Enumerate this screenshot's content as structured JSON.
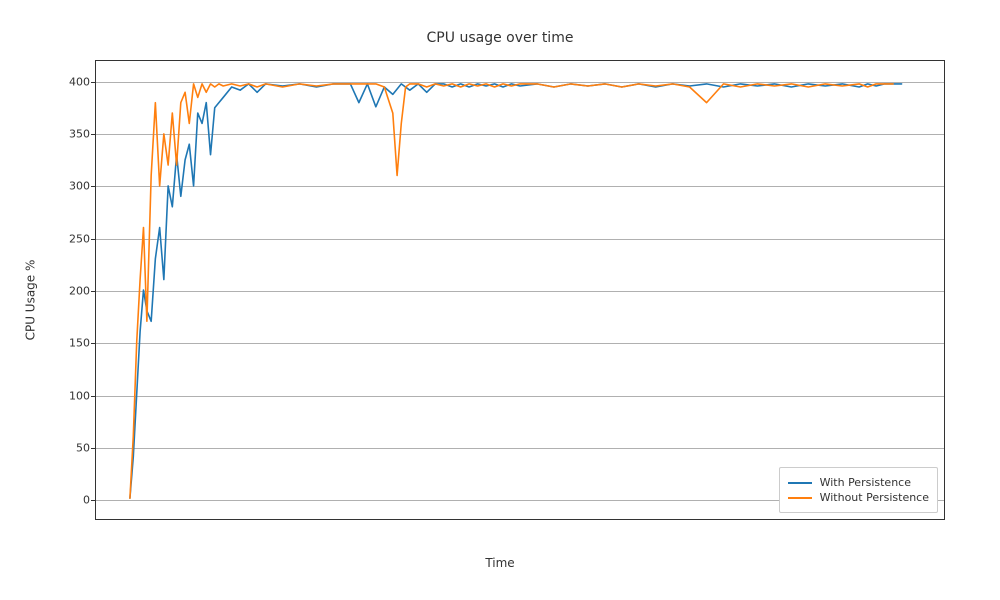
{
  "chart_data": {
    "type": "line",
    "title": "CPU usage over time",
    "xlabel": "Time",
    "ylabel": "CPU Usage %",
    "ylim": [
      -20,
      420
    ],
    "xlim": [
      0,
      100
    ],
    "yticks": [
      0,
      50,
      100,
      150,
      200,
      250,
      300,
      350,
      400
    ],
    "legend_position": "lower right",
    "grid": true,
    "series": [
      {
        "name": "With Persistence",
        "color": "#1f77b4",
        "x": [
          4,
          4.4,
          4.8,
          5.2,
          5.6,
          6,
          6.5,
          7,
          7.5,
          8,
          8.5,
          9,
          9.5,
          10,
          10.5,
          11,
          11.5,
          12,
          12.5,
          13,
          13.5,
          14,
          14.5,
          15,
          16,
          17,
          18,
          19,
          20,
          22,
          24,
          26,
          28,
          30,
          31,
          32,
          33,
          34,
          35,
          36,
          37,
          38,
          39,
          40,
          41,
          42,
          43,
          44,
          45,
          46,
          47,
          48,
          49,
          50,
          52,
          54,
          56,
          58,
          60,
          62,
          64,
          66,
          68,
          70,
          72,
          74,
          76,
          78,
          80,
          82,
          84,
          86,
          88,
          90,
          91,
          92,
          93,
          94,
          95
        ],
        "y": [
          0,
          40,
          100,
          160,
          200,
          180,
          170,
          230,
          260,
          210,
          300,
          280,
          330,
          290,
          325,
          340,
          300,
          370,
          360,
          380,
          330,
          375,
          380,
          385,
          395,
          392,
          398,
          390,
          398,
          396,
          398,
          395,
          398,
          398,
          380,
          398,
          376,
          395,
          388,
          398,
          392,
          398,
          390,
          398,
          398,
          395,
          398,
          395,
          398,
          396,
          398,
          395,
          398,
          396,
          398,
          395,
          398,
          396,
          398,
          395,
          398,
          395,
          398,
          396,
          398,
          395,
          398,
          396,
          398,
          395,
          398,
          396,
          398,
          395,
          398,
          396,
          398,
          398,
          398
        ]
      },
      {
        "name": "Without Persistence",
        "color": "#ff7f0e",
        "x": [
          4,
          4.4,
          4.8,
          5.2,
          5.6,
          6,
          6.5,
          7,
          7.5,
          8,
          8.5,
          9,
          9.5,
          10,
          10.5,
          11,
          11.5,
          12,
          12.5,
          13,
          13.5,
          14,
          14.5,
          15,
          16,
          17,
          18,
          19,
          20,
          22,
          24,
          26,
          28,
          30,
          31,
          32,
          33,
          34,
          35,
          35.5,
          36,
          36.5,
          37,
          38,
          39,
          40,
          41,
          42,
          43,
          44,
          45,
          46,
          47,
          48,
          49,
          50,
          52,
          54,
          56,
          58,
          60,
          62,
          64,
          66,
          68,
          70,
          72,
          74,
          76,
          78,
          80,
          82,
          84,
          86,
          88,
          90,
          91,
          92,
          93,
          94
        ],
        "y": [
          0,
          60,
          150,
          210,
          260,
          170,
          310,
          380,
          300,
          350,
          320,
          370,
          320,
          380,
          390,
          360,
          398,
          385,
          398,
          390,
          398,
          395,
          398,
          396,
          398,
          396,
          398,
          395,
          398,
          395,
          398,
          396,
          398,
          398,
          398,
          398,
          398,
          395,
          370,
          310,
          360,
          395,
          398,
          398,
          395,
          398,
          396,
          398,
          395,
          398,
          396,
          398,
          395,
          398,
          396,
          398,
          398,
          395,
          398,
          396,
          398,
          395,
          398,
          396,
          398,
          395,
          380,
          398,
          395,
          398,
          396,
          398,
          395,
          398,
          396,
          398,
          395,
          398,
          398,
          398
        ]
      }
    ]
  },
  "legend": {
    "items": [
      "With Persistence",
      "Without Persistence"
    ]
  }
}
